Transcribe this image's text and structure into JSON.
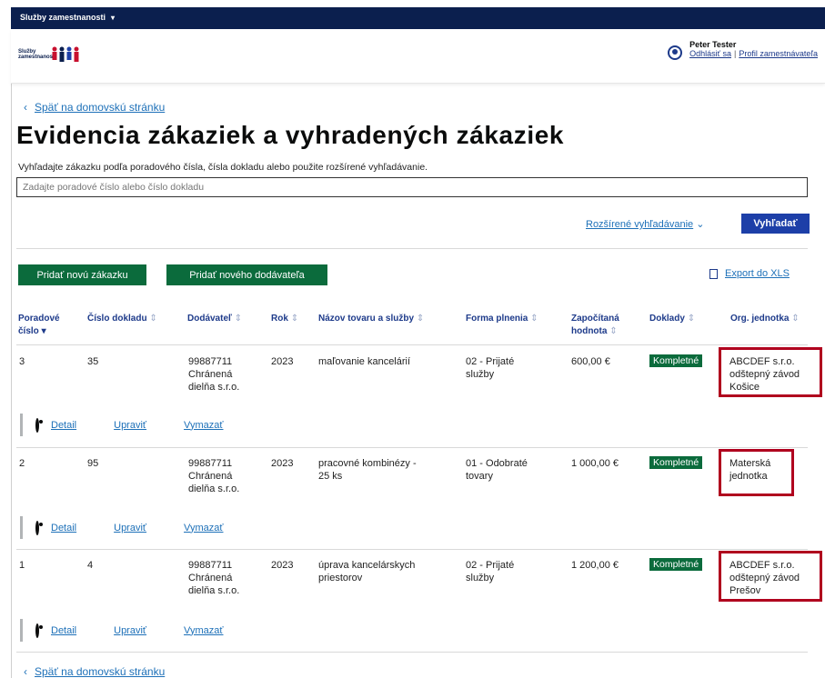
{
  "topbar": {
    "title": "Služby zamestnanosti",
    "caret": "▾"
  },
  "header": {
    "logo_text": "Služby zamestnanosti",
    "user_name": "Peter Tester",
    "logout_label": "Odhlásiť sa",
    "separator": "|",
    "profile_label": "Profil zamestnávateľa"
  },
  "page": {
    "back_label": "Späť na domovskú stránku",
    "title": "Evidencia zákaziek a vyhradených zákaziek",
    "hint": "Vyhľadajte zákazku podľa poradového čísla, čísla dokladu alebo použite rozšírené vyhľadávanie.",
    "search_placeholder": "Zadajte poradové číslo alebo číslo dokladu",
    "advanced_search_label": "Rozšírené vyhľadávanie",
    "advanced_caret": "⌄",
    "search_button_label": "Vyhľadať",
    "add_order_label": "Pridať novú zákazku",
    "add_supplier_label": "Pridať nového dodávateľa",
    "export_label": "Export do XLS"
  },
  "table": {
    "headers": {
      "poradove": "Poradové",
      "poradove2": "číslo",
      "cislo_dokladu": "Číslo dokladu",
      "dodavatel": "Dodávateľ",
      "rok": "Rok",
      "nazov": "Názov tovaru a služby",
      "forma": "Forma plnenia",
      "zapocitana": "Započítaná",
      "hodnota": "hodnota",
      "doklady": "Doklady",
      "org": "Org. jednotka"
    },
    "rows": [
      {
        "poradove": "3",
        "cislo_dokladu": "35",
        "dodavatel_1": "99887711",
        "dodavatel_2": "Chránená",
        "dodavatel_3": "dielňa s.r.o.",
        "rok": "2023",
        "nazov_1": "maľovanie kancelárií",
        "nazov_2": "",
        "forma_1": "02 - Prijaté",
        "forma_2": "služby",
        "hodnota": "600,00 €",
        "doklady": "Kompletné",
        "org_1": "ABCDEF s.r.o.",
        "org_2": "odštepný závod",
        "org_3": "Košice"
      },
      {
        "poradove": "2",
        "cislo_dokladu": "95",
        "dodavatel_1": "99887711",
        "dodavatel_2": "Chránená",
        "dodavatel_3": "dielňa s.r.o.",
        "rok": "2023",
        "nazov_1": "pracovné kombinézy -",
        "nazov_2": "25 ks",
        "forma_1": "01 - Odobraté",
        "forma_2": "tovary",
        "hodnota": "1 000,00 €",
        "doklady": "Kompletné",
        "org_1": "Materská",
        "org_2": "jednotka",
        "org_3": ""
      },
      {
        "poradove": "1",
        "cislo_dokladu": "4",
        "dodavatel_1": "99887711",
        "dodavatel_2": "Chránená",
        "dodavatel_3": "dielňa s.r.o.",
        "rok": "2023",
        "nazov_1": "úprava kancelárskych",
        "nazov_2": "priestorov",
        "forma_1": "02 - Prijaté",
        "forma_2": "služby",
        "hodnota": "1 200,00 €",
        "doklady": "Kompletné",
        "org_1": "ABCDEF s.r.o.",
        "org_2": "odštepný závod",
        "org_3": "Prešov"
      }
    ],
    "actions": {
      "detail": "Detail",
      "edit": "Upraviť",
      "delete": "Vymazať"
    }
  },
  "icons": [
    "user-icon",
    "eye-icon",
    "pencil-icon",
    "trash-icon",
    "export-doc-icon",
    "chevron-left-icon",
    "sort-icon"
  ],
  "colors": {
    "topbar": "#0b1f4e",
    "primary": "#1d3fa8",
    "green": "#0b6b3c",
    "highlight": "#b0001e",
    "link": "#1d70b8"
  }
}
